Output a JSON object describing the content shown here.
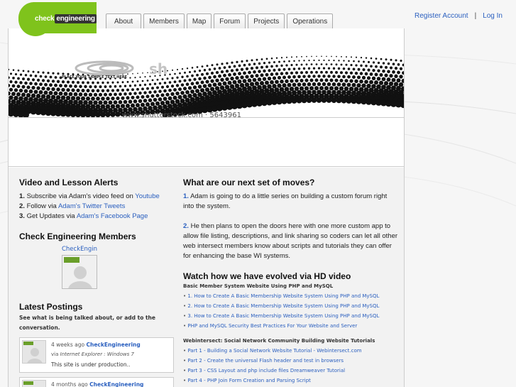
{
  "header": {
    "logo": {
      "part1": "check",
      "part2": "engineering"
    },
    "nav": [
      "About",
      "Members",
      "Map",
      "Forum",
      "Projects",
      "Operations"
    ],
    "account": {
      "register": "Register Account",
      "separator": "|",
      "login": "Log In"
    }
  },
  "banner": {
    "watermark_text": "PLACE YOUR SAMPLE TEXT HERE",
    "watermark_url": "www.shutterstock.com · 5643961"
  },
  "alerts": {
    "title": "Video and Lesson Alerts",
    "items": [
      {
        "num": "1.",
        "text": "Subscribe via Adam's video feed on ",
        "link": "Youtube"
      },
      {
        "num": "2.",
        "text": "Follow via ",
        "link": "Adam's Twitter Tweets"
      },
      {
        "num": "3.",
        "text": "Get Updates via ",
        "link": "Adam's Facebook Page"
      }
    ]
  },
  "members": {
    "title": "Check Engineering Members",
    "name": "CheckEngin"
  },
  "postings": {
    "title": "Latest Postings",
    "subtitle": "See what is being talked about, or add to the conversation.",
    "items": [
      {
        "time": "4 weeks ago",
        "user": "CheckEngineering",
        "via_label": "via",
        "client": "Internet Explorer : Windows 7",
        "message": "This site is under production.."
      },
      {
        "time": "4 months ago",
        "user": "CheckEngineering",
        "via_label": "",
        "client": "",
        "message": ""
      }
    ]
  },
  "moves": {
    "title": "What are our next set of moves?",
    "p1_num": "1.",
    "p1": "Adam is going to do a little series on building a custom forum right into the system.",
    "p2_num": "2.",
    "p2": "He then plans to open the doors here with one more custom app to allow file listing, descriptions, and link sharing so coders can let all other web intersect members know about scripts and tutorials they can offer for enhancing the base WI systems."
  },
  "videos": {
    "title": "Watch how we have evolved via HD video",
    "section1": "Basic Member System Website Using PHP and MySQL",
    "links1": [
      "1. How to Create A Basic Membership Website System Using PHP and MySQL",
      "2. How to Create A Basic Membership Website System Using PHP and MySQL",
      "3. How to Create A Basic Membership Website System Using PHP and MySQL",
      "PHP and MySQL Security Best Practices For Your Website and Server"
    ],
    "section2": "Webintersect: Social Network Community Building Website Tutorials",
    "links2": [
      "Part 1 - Building a Social Network Website Tutorial - Webintersect.com",
      "Part 2 - Create the universal Flash header and test in browsers",
      "Part 3 - CSS Layout and php include files Dreamweaver Tutorial",
      "Part 4 - PHP Join Form Creation and Parsing Script"
    ]
  },
  "colors": {
    "accent": "#7fc31c",
    "link": "#2a5fbf"
  }
}
